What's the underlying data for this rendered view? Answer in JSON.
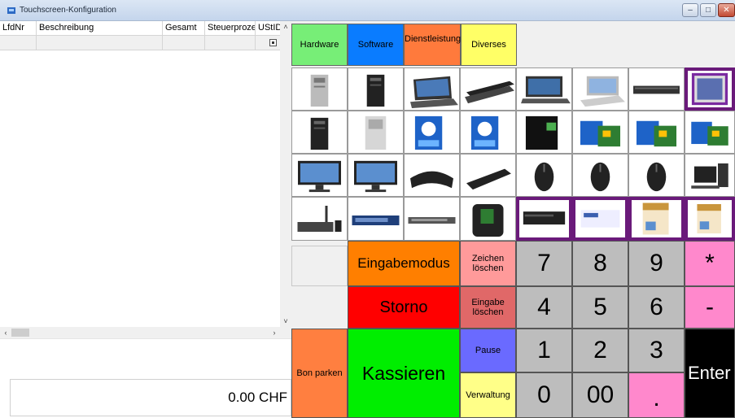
{
  "window": {
    "title": "Touchscreen-Konfiguration",
    "min": "–",
    "max": "□",
    "close": "✕"
  },
  "grid": {
    "columns": [
      "LfdNr",
      "Beschreibung",
      "Gesamt",
      "Steuerprozent",
      "UStID"
    ],
    "scroll_up": "˄",
    "scroll_down": "˅",
    "scroll_left": "‹",
    "scroll_right": "›"
  },
  "total": "0.00 CHF",
  "categories": [
    {
      "label": "Hardware",
      "color": "#77ee77"
    },
    {
      "label": "Software",
      "color": "#0a7cff"
    },
    {
      "label": "Dienstleistung",
      "color": "#ff7a3c"
    },
    {
      "label": "Diverses",
      "color": "#ffff66"
    }
  ],
  "products": [
    [
      "tower-pc",
      "tower-pc-black",
      "laptop",
      "laptop-black",
      "laptop-dark",
      "laptop-silver",
      "rack-server",
      "cd-spindle"
    ],
    [
      "tower-pc-black",
      "tower-pc-silver",
      "cpu-box-blue",
      "cpu-box-blue",
      "cpu-box-black",
      "motherboard",
      "motherboard",
      "motherboard"
    ],
    [
      "monitor",
      "monitor",
      "keyboard-ergonomic",
      "keyboard",
      "mouse-black",
      "mouse-black",
      "mouse-black",
      "pc-set"
    ],
    [
      "router",
      "switch",
      "switch-flat",
      "camera-bag",
      "dvd-drive",
      "toner-box",
      "software-box",
      "software-box"
    ]
  ],
  "buttons": {
    "eingabemodus": "Eingabemodus",
    "storno": "Storno",
    "kassieren": "Kassieren",
    "bon_parken": "Bon parken",
    "zeichen_loeschen": "Zeichen löschen",
    "eingabe_loeschen": "Eingabe löschen",
    "pause": "Pause",
    "verwaltung": "Verwaltung",
    "enter": "Enter"
  },
  "keypad": {
    "row1": [
      "7",
      "8",
      "9"
    ],
    "row2": [
      "4",
      "5",
      "6"
    ],
    "row3": [
      "1",
      "2",
      "3"
    ],
    "row4": [
      "0",
      "00",
      "."
    ],
    "star": "*",
    "minus": "-"
  },
  "colors": {
    "eingabemodus": "#ff7f00",
    "storno": "#ff0000",
    "kassieren": "#00ee00",
    "bon_parken": "#ff7f40",
    "zeichen_loeschen": "#ff9a9a",
    "eingabe_loeschen": "#e06868",
    "pause": "#6a6aff",
    "verwaltung": "#ffff88",
    "pink": "#ff88cc",
    "enter": "#000000"
  }
}
